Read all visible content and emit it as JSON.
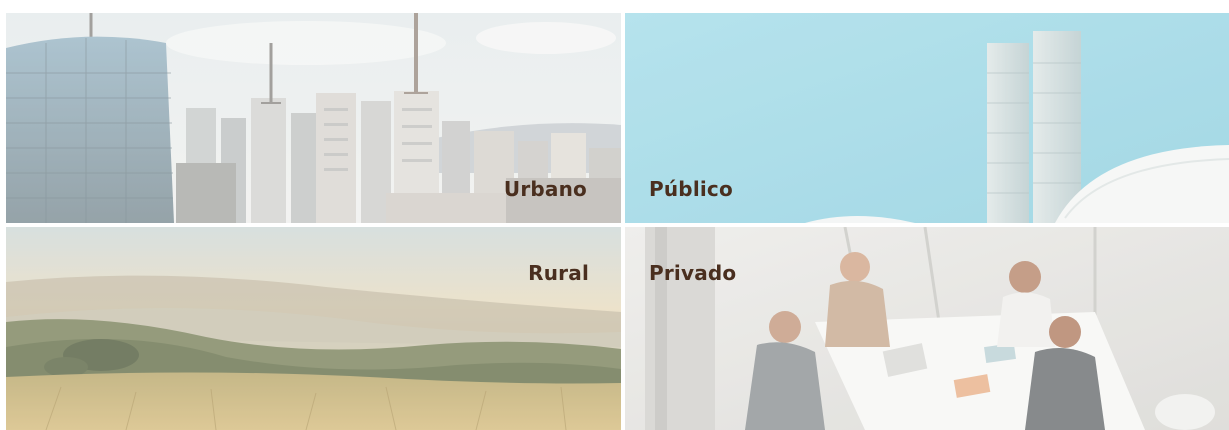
{
  "tiles": {
    "urbano": {
      "label": "Urbano"
    },
    "publico": {
      "label": "Público"
    },
    "rural": {
      "label": "Rural"
    },
    "privado": {
      "label": "Privado"
    }
  },
  "colors": {
    "label_text": "#4a2f1f",
    "sky_city": "#e9ecec",
    "sky_public": "#9fdbe7",
    "field_gold": "#c9b27a",
    "office_light": "#e6e6e3"
  }
}
